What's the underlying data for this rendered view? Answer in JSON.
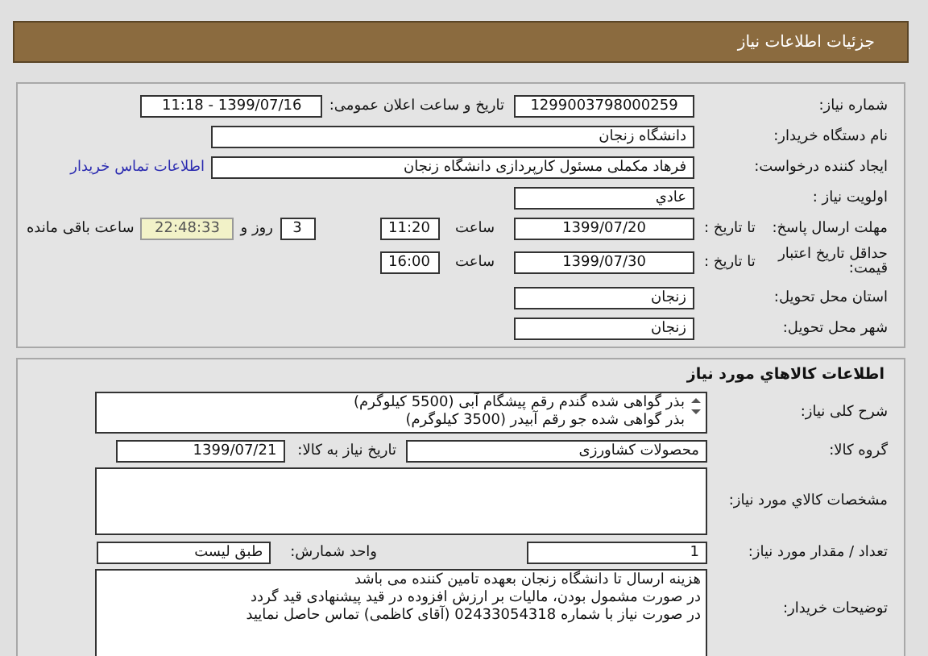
{
  "header": {
    "title": "جزئیات اطلاعات نیاز"
  },
  "need_info": {
    "need_number": {
      "label": "شماره نیاز:",
      "value": "1299003798000259"
    },
    "announce": {
      "label": "تاریخ و ساعت اعلان عمومی:",
      "value": "1399/07/16 - 11:18"
    },
    "buyer": {
      "label": "نام دستگاه خریدار:",
      "value": "دانشگاه زنجان"
    },
    "requester": {
      "label": "ایجاد کننده درخواست:",
      "value": "فرهاد مکملی مسئول کارپردازی دانشگاه زنجان",
      "contact_link": "اطلاعات تماس خریدار"
    },
    "priority": {
      "label": "اولویت نیاز :",
      "value": "عادي"
    },
    "response_deadline": {
      "label": "مهلت ارسال پاسخ:",
      "to_date_label": "تا تاریخ :",
      "date": "1399/07/20",
      "time_label": "ساعت",
      "time": "11:20",
      "days": "3",
      "days_label": "روز و",
      "remaining": "22:48:33",
      "remaining_label": "ساعت باقی مانده"
    },
    "price_validity": {
      "label": "حداقل تاریخ اعتبار قیمت:",
      "to_date_label": "تا تاریخ :",
      "date": "1399/07/30",
      "time_label": "ساعت",
      "time": "16:00"
    },
    "province": {
      "label": "استان محل تحویل:",
      "value": "زنجان"
    },
    "city": {
      "label": "شهر محل تحویل:",
      "value": "زنجان"
    }
  },
  "goods": {
    "title": "اطلاعات کالاهاي مورد نیاز",
    "description": {
      "label": "شرح کلی نیاز:",
      "lines": [
        "بذر گواهی شده گندم رقم پیشگام آبی (5500 کیلوگرم)",
        "بذر گواهی شده جو رقم آبیدر (3500 کیلوگرم)"
      ]
    },
    "group": {
      "label": "گروه کالا:",
      "value": "محصولات کشاورزی",
      "need_date_label": "تاریخ نیاز به کالا:",
      "need_date": "1399/07/21"
    },
    "specs": {
      "label": "مشخصات کالاي مورد نیاز:"
    },
    "quantity": {
      "label": "تعداد / مقدار مورد نیاز:",
      "value": "1",
      "unit_label": "واحد شمارش:",
      "unit": "طبق لیست"
    },
    "buyer_notes": {
      "label": "توضیحات خریدار:",
      "lines": [
        "هزینه ارسال تا دانشگاه زنجان بعهده تامین کننده می باشد",
        "در صورت مشمول بودن، مالیات بر ارزش افزوده در قید پیشنهادی قید گردد",
        "در صورت نیاز با شماره 02433054318 (آقای کاظمی) تماس حاصل نمایید"
      ]
    }
  }
}
